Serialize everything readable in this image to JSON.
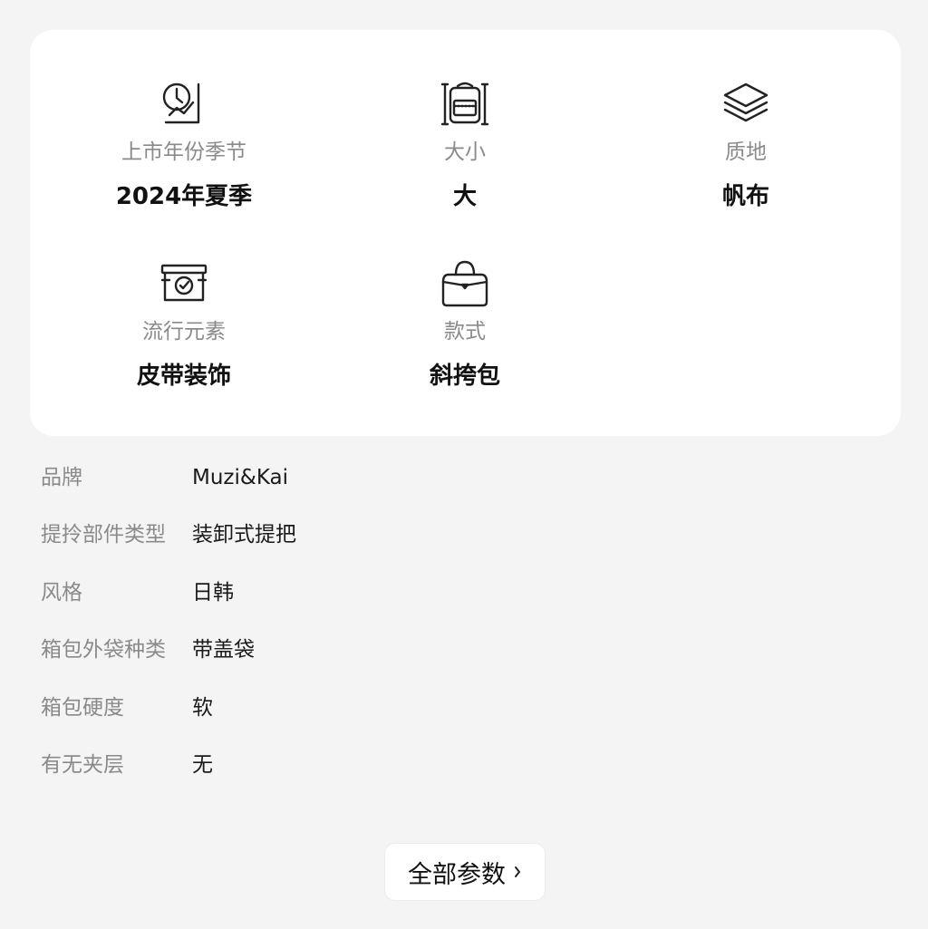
{
  "features": [
    {
      "icon": "calendar-clock-icon",
      "label": "上市年份季节",
      "value": "2024年夏季"
    },
    {
      "icon": "backpack-size-icon",
      "label": "大小",
      "value": "大"
    },
    {
      "icon": "layers-icon",
      "label": "质地",
      "value": "帆布"
    },
    {
      "icon": "badge-box-icon",
      "label": "流行元素",
      "value": "皮带装饰"
    },
    {
      "icon": "handbag-icon",
      "label": "款式",
      "value": "斜挎包"
    }
  ],
  "params": [
    {
      "key": "品牌",
      "value": "Muzi&Kai"
    },
    {
      "key": "提拎部件类型",
      "value": "装卸式提把"
    },
    {
      "key": "风格",
      "value": "日韩"
    },
    {
      "key": "箱包外袋种类",
      "value": "带盖袋"
    },
    {
      "key": "箱包硬度",
      "value": "软"
    },
    {
      "key": "有无夹层",
      "value": "无"
    }
  ],
  "all_params_button": {
    "label": "全部参数",
    "icon": "chevron-right-icon"
  }
}
